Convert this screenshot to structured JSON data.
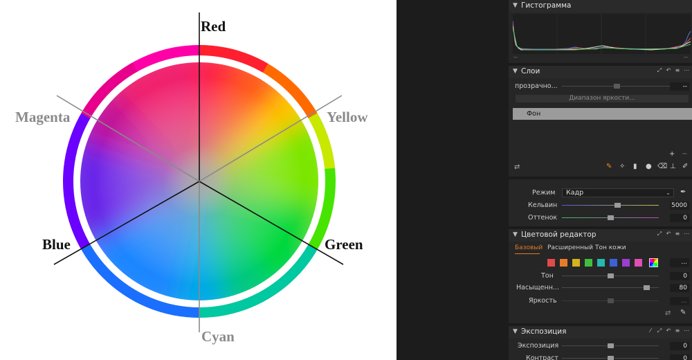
{
  "color_wheel": {
    "labels": {
      "red": "Red",
      "yellow": "Yellow",
      "green": "Green",
      "cyan": "Cyan",
      "blue": "Blue",
      "magenta": "Magenta"
    }
  },
  "histogram": {
    "title": "Гистограмма",
    "readout_left": "--",
    "readout_right": "--"
  },
  "layers": {
    "title": "Слои",
    "opacity_label": "прозрачно...",
    "opacity_value": "--",
    "luma_range_label": "Диапазон яркости...",
    "layer_name": "Фон",
    "tool_icons": [
      "brush-icon",
      "magic-brush-icon",
      "gradient-icon",
      "radial-icon",
      "eraser-icon",
      "fill-icon",
      "clone-icon"
    ]
  },
  "white_balance": {
    "mode_label": "Режим",
    "mode_value": "Кадр",
    "kelvin_label": "Кельвин",
    "kelvin_value": "5000",
    "kelvin_level": 0.58,
    "tint_label": "Оттенок",
    "tint_value": "0",
    "tint_level": 0.5
  },
  "color_editor": {
    "title": "Цветовой редактор",
    "tabs": [
      "Базовый",
      "Расширенный",
      "Тон кожи"
    ],
    "active_tab_color": "#e07a2a",
    "swatches": [
      "#e34a4a",
      "#e97c2a",
      "#d6b21c",
      "#3fbf3f",
      "#25b8b0",
      "#3b62d8",
      "#9b3fd0",
      "#e04fb4"
    ],
    "more_label": "...",
    "hue_label": "Тон",
    "hue_value": "0",
    "hue_level": 0.5,
    "saturation_label": "Насыщенн...",
    "saturation_value": "80",
    "saturation_level": 0.9,
    "lightness_label": "Яркость",
    "lightness_value": "...",
    "lightness_level": 0.5
  },
  "exposure": {
    "title": "Экспозиция",
    "exposure_label": "Экспозиция",
    "exposure_value": "0",
    "exposure_level": 0.5,
    "contrast_label": "Контраст",
    "contrast_value": "0",
    "contrast_level": 0.5
  }
}
